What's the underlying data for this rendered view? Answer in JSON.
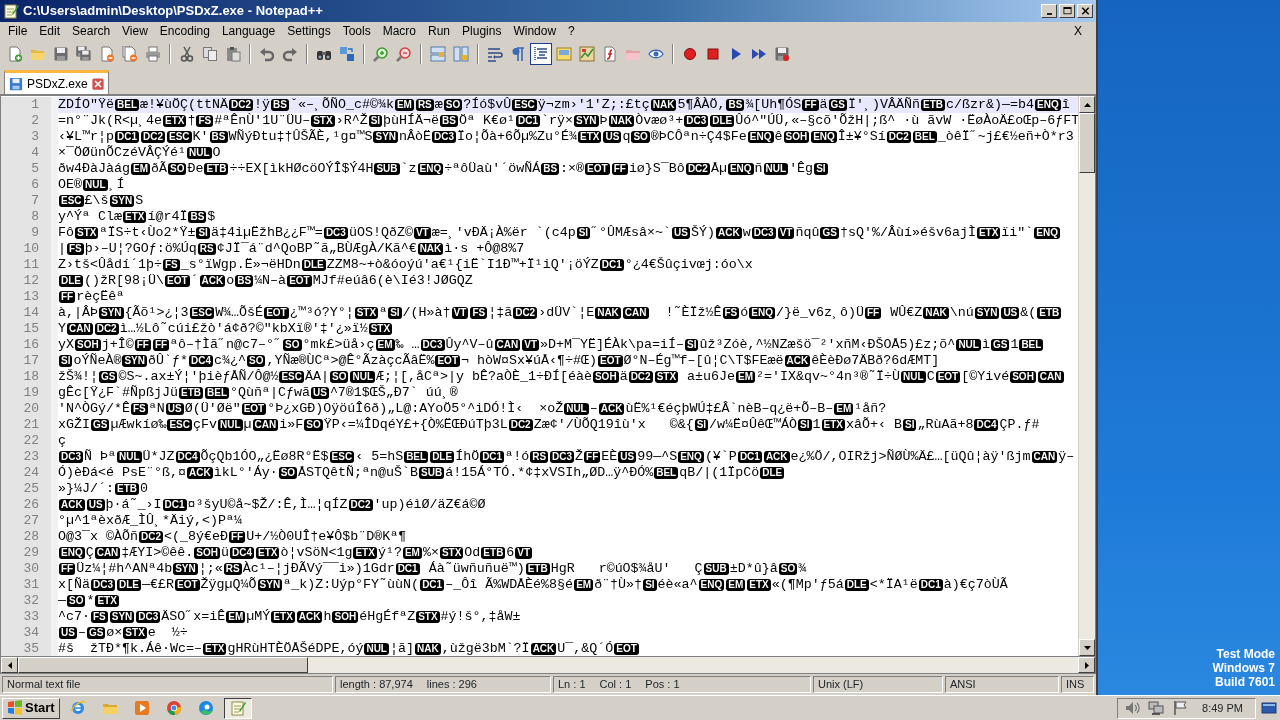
{
  "window": {
    "title": "C:\\Users\\admin\\Desktop\\PSDxZ.exe - Notepad++"
  },
  "menu": [
    {
      "label": "File"
    },
    {
      "label": "Edit"
    },
    {
      "label": "Search"
    },
    {
      "label": "View"
    },
    {
      "label": "Encoding"
    },
    {
      "label": "Language"
    },
    {
      "label": "Settings"
    },
    {
      "label": "Tools"
    },
    {
      "label": "Macro"
    },
    {
      "label": "Run"
    },
    {
      "label": "Plugins"
    },
    {
      "label": "Window"
    },
    {
      "label": "?"
    }
  ],
  "menu_close": "X",
  "toolbar": [
    {
      "kind": "new",
      "on": false
    },
    {
      "kind": "open",
      "on": false
    },
    {
      "kind": "save",
      "on": false
    },
    {
      "kind": "saveall",
      "on": false
    },
    {
      "kind": "close",
      "on": false
    },
    {
      "kind": "closeall",
      "on": false
    },
    {
      "kind": "print",
      "on": false
    },
    {
      "kind": "sep"
    },
    {
      "kind": "cut",
      "on": false
    },
    {
      "kind": "copy",
      "on": false
    },
    {
      "kind": "paste",
      "on": false
    },
    {
      "kind": "sep"
    },
    {
      "kind": "undo",
      "on": false
    },
    {
      "kind": "redo",
      "on": false
    },
    {
      "kind": "sep"
    },
    {
      "kind": "find",
      "on": false
    },
    {
      "kind": "replace",
      "on": false
    },
    {
      "kind": "sep"
    },
    {
      "kind": "zoomin",
      "on": false
    },
    {
      "kind": "zoomout",
      "on": false
    },
    {
      "kind": "sep"
    },
    {
      "kind": "syncv",
      "on": false
    },
    {
      "kind": "synch",
      "on": false
    },
    {
      "kind": "sep"
    },
    {
      "kind": "wrap",
      "on": false
    },
    {
      "kind": "allchars",
      "on": false
    },
    {
      "kind": "indent",
      "on": true
    },
    {
      "kind": "udl",
      "on": false
    },
    {
      "kind": "map",
      "on": false
    },
    {
      "kind": "funclist",
      "on": false
    },
    {
      "kind": "folder",
      "on": false
    },
    {
      "kind": "monitor",
      "on": false
    },
    {
      "kind": "sep"
    },
    {
      "kind": "record",
      "on": false
    },
    {
      "kind": "stop",
      "on": false
    },
    {
      "kind": "play",
      "on": false
    },
    {
      "kind": "playmulti",
      "on": false
    },
    {
      "kind": "savemacro",
      "on": false
    }
  ],
  "tabs": [
    {
      "label": "PSDxZ.exe",
      "selected": true
    }
  ],
  "editor": {
    "lines": [
      {
        "number": "1",
        "current": true,
        "segments": [
          {
            "text": "ZDÍO\"Ÿë"
          },
          {
            "ctrl": "BEL"
          },
          {
            "text": "æ!¥ùÖÇ(ttNÄ"
          },
          {
            "ctrl": "DC2"
          },
          {
            "text": "!ÿ"
          },
          {
            "ctrl": "BS"
          },
          {
            "text": "ˇ«–¸ÕÑO_c#©¾k"
          },
          {
            "ctrl": "EM"
          },
          {
            "ctrl": "RS"
          },
          {
            "text": "æ"
          },
          {
            "ctrl": "SO"
          },
          {
            "text": "?Íó$vÛ"
          },
          {
            "ctrl": "ESC"
          },
          {
            "text": "ÿ¬zm›'1'Z;:£tç"
          },
          {
            "ctrl": "NAK"
          },
          {
            "text": "5¶ÂÀÖ,"
          },
          {
            "ctrl": "BS"
          },
          {
            "text": "¾[Uh¶ÓS"
          },
          {
            "ctrl": "FF"
          },
          {
            "text": "ä"
          },
          {
            "ctrl": "GS"
          },
          {
            "text": "Ï'¸)VÂÄÑñ"
          },
          {
            "ctrl": "ETB"
          },
          {
            "text": "c/ßzr&)—=b4"
          },
          {
            "ctrl": "ENQ"
          },
          {
            "text": "î"
          }
        ]
      },
      {
        "number": "2",
        "current": false,
        "segments": [
          {
            "text": "=n°¨Jk(R<µ¸4e"
          },
          {
            "ctrl": "ETX"
          },
          {
            "text": "†"
          },
          {
            "ctrl": "FS"
          },
          {
            "text": "#ªÊnÙ'1U¨ÜU–"
          },
          {
            "ctrl": "STX"
          },
          {
            "text": "›R^Ž"
          },
          {
            "ctrl": "SI"
          },
          {
            "text": "þùHÍÄ¬ë"
          },
          {
            "ctrl": "BS"
          },
          {
            "text": "Öª K€ø¹"
          },
          {
            "ctrl": "DC1"
          },
          {
            "text": "`rÿ×"
          },
          {
            "ctrl": "SYN"
          },
          {
            "text": "Þ"
          },
          {
            "ctrl": "NAK"
          },
          {
            "text": "Òvæø³+"
          },
          {
            "ctrl": "DC3"
          },
          {
            "ctrl": "DLE"
          },
          {
            "text": "Ûó^\"ÚÜ,«–§cõ'ÕžH|;ß^ ·ù ãvW ·ËøÀoÄ£oŒp–6ƒFT"
          }
        ]
      },
      {
        "number": "3",
        "current": false,
        "segments": [
          {
            "text": "‹¥L™r¦p"
          },
          {
            "ctrl": "DC1"
          },
          {
            "ctrl": "DC2"
          },
          {
            "ctrl": "ESC"
          },
          {
            "text": "K'"
          },
          {
            "ctrl": "BS"
          },
          {
            "text": "WÑýÐtu‡†ÛŠÃÈ,¹g¤™S"
          },
          {
            "ctrl": "SYN"
          },
          {
            "text": "nÂòË"
          },
          {
            "ctrl": "DC3"
          },
          {
            "text": "Ïo¦Õà+6Õµ%Zu°É¾"
          },
          {
            "ctrl": "ETX"
          },
          {
            "ctrl": "US"
          },
          {
            "text": "q"
          },
          {
            "ctrl": "SO"
          },
          {
            "text": "®ÞCÔªn÷Ç4$Fe"
          },
          {
            "ctrl": "ENQ"
          },
          {
            "text": "ê"
          },
          {
            "ctrl": "SOH"
          },
          {
            "ctrl": "ENQ"
          },
          {
            "text": "Î±¥°Sí"
          },
          {
            "ctrl": "DC2"
          },
          {
            "ctrl": "BEL"
          },
          {
            "text": "_òêÏ˝~j£€½eñ+Ò*r3"
          }
        ]
      },
      {
        "number": "4",
        "current": false,
        "segments": [
          {
            "text": "×¯ÖØünÕCzéVÂÇÝé¹"
          },
          {
            "ctrl": "NUL"
          },
          {
            "text": "O"
          }
        ]
      },
      {
        "number": "5",
        "current": false,
        "segments": [
          {
            "text": "ðw4ÐàJàág"
          },
          {
            "ctrl": "EM"
          },
          {
            "text": "ðÃ"
          },
          {
            "ctrl": "SO"
          },
          {
            "text": "Ðe"
          },
          {
            "ctrl": "ETB"
          },
          {
            "text": "÷÷EX[ìkHØcöOÝÎ$Ý4H"
          },
          {
            "ctrl": "SUB"
          },
          {
            "text": "`z"
          },
          {
            "ctrl": "ENQ"
          },
          {
            "text": "÷ªôÜaù'´öwÑÁ"
          },
          {
            "ctrl": "BS"
          },
          {
            "text": ":×®"
          },
          {
            "ctrl": "EOT"
          },
          {
            "ctrl": "FF"
          },
          {
            "text": "iø}S¯Bô"
          },
          {
            "ctrl": "DC2"
          },
          {
            "text": "Åµ"
          },
          {
            "ctrl": "ENQ"
          },
          {
            "text": "ñ"
          },
          {
            "ctrl": "NUL"
          },
          {
            "text": "'Êg"
          },
          {
            "ctrl": "SI"
          }
        ]
      },
      {
        "number": "6",
        "current": false,
        "segments": [
          {
            "text": "OE®"
          },
          {
            "ctrl": "NUL"
          },
          {
            "text": "¸Í"
          }
        ]
      },
      {
        "number": "7",
        "current": false,
        "segments": [
          {
            "ctrl": "ESC"
          },
          {
            "text": "£\\š"
          },
          {
            "ctrl": "SYN"
          },
          {
            "text": "S"
          }
        ]
      },
      {
        "number": "8",
        "current": false,
        "segments": [
          {
            "text": "y^Ýª Clæ"
          },
          {
            "ctrl": "ETX"
          },
          {
            "text": "í@r4Ï"
          },
          {
            "ctrl": "BS"
          },
          {
            "text": "$"
          }
        ]
      },
      {
        "number": "9",
        "current": false,
        "segments": [
          {
            "text": "Fô"
          },
          {
            "ctrl": "STX"
          },
          {
            "text": "ªÏS÷t‹Ùo2*Ÿ±"
          },
          {
            "ctrl": "SI"
          },
          {
            "text": "ä‡4iµËžhB¿¿F™="
          },
          {
            "ctrl": "DC3"
          },
          {
            "text": "üOS!QðZ©"
          },
          {
            "ctrl": "VT"
          },
          {
            "text": "æ=¸'vÐÄ¡À%ër `(c4p"
          },
          {
            "ctrl": "SI"
          },
          {
            "text": "˝°ÛMÆsâ×~`"
          },
          {
            "ctrl": "US"
          },
          {
            "text": "ŠÝ)"
          },
          {
            "ctrl": "ACK"
          },
          {
            "text": "w"
          },
          {
            "ctrl": "DC3"
          },
          {
            "ctrl": "VT"
          },
          {
            "text": "ñqû"
          },
          {
            "ctrl": "GS"
          },
          {
            "text": "†sQ'%/Âùí»éšv6ajÌ"
          },
          {
            "ctrl": "ETX"
          },
          {
            "text": "ïi\"`"
          },
          {
            "ctrl": "ENQ"
          }
        ]
      },
      {
        "number": "10",
        "current": false,
        "segments": [
          {
            "text": "|"
          },
          {
            "ctrl": "FS"
          },
          {
            "text": "þ›–U¦?GOƒ:ö%Úq"
          },
          {
            "ctrl": "RS"
          },
          {
            "text": "¢JÏ¯á¨d^QoBP˜ã„BÙÆgÀ/Kã^€"
          },
          {
            "ctrl": "NAK"
          },
          {
            "text": "ì·s +Ô@8%7"
          }
        ]
      },
      {
        "number": "11",
        "current": false,
        "segments": [
          {
            "text": "Z›tš<Ûådí´1þ÷"
          },
          {
            "ctrl": "FS"
          },
          {
            "text": "_s°ïWgp.Ë»¬ëHDn"
          },
          {
            "ctrl": "DLE"
          },
          {
            "text": "ZZM8~+ò&óoýú'a€¹{iË`I1Ð™+Ï¹iQ'¡öÝZ"
          },
          {
            "ctrl": "DC1"
          },
          {
            "text": "°¿4€Šûçivœj:óo\\x"
          }
        ]
      },
      {
        "number": "12",
        "current": false,
        "segments": [
          {
            "ctrl": "DLE"
          },
          {
            "text": "()žR[98¡Ü\\"
          },
          {
            "ctrl": "EOT"
          },
          {
            "text": "´"
          },
          {
            "ctrl": "ACK"
          },
          {
            "text": "o"
          },
          {
            "ctrl": "BS"
          },
          {
            "text": "¼N–à"
          },
          {
            "ctrl": "EOT"
          },
          {
            "text": "MJf#eúâ6(è\\Ié3!JØGQZ"
          }
        ]
      },
      {
        "number": "13",
        "current": false,
        "segments": [
          {
            "ctrl": "FF"
          },
          {
            "text": "rèçËêª"
          }
        ]
      },
      {
        "number": "14",
        "current": false,
        "segments": [
          {
            "text": "à,|ÂÞ"
          },
          {
            "ctrl": "SYN"
          },
          {
            "text": "{Ãõ¹>¿¦3"
          },
          {
            "ctrl": "ESC"
          },
          {
            "text": "W¾…ÕšÉ"
          },
          {
            "ctrl": "EOT"
          },
          {
            "text": "¿™³ó?Y°¦"
          },
          {
            "ctrl": "STX"
          },
          {
            "text": "ª"
          },
          {
            "ctrl": "SI"
          },
          {
            "text": "/(H»à†"
          },
          {
            "ctrl": "VT"
          },
          {
            "ctrl": "FS"
          },
          {
            "text": "¦‡ã"
          },
          {
            "ctrl": "DC2"
          },
          {
            "text": "›dÜV`¦E"
          },
          {
            "ctrl": "NAK"
          },
          {
            "ctrl": "CAN"
          },
          {
            "text": "  !˜ÈÏž½Ê"
          },
          {
            "ctrl": "FS"
          },
          {
            "text": "ó"
          },
          {
            "ctrl": "ENQ"
          },
          {
            "text": "/}ë_v6z¸ô)Ü"
          },
          {
            "ctrl": "FF"
          },
          {
            "text": " WÛ€Z"
          },
          {
            "ctrl": "NAK"
          },
          {
            "text": "\\nú"
          },
          {
            "ctrl": "SYN"
          },
          {
            "ctrl": "US"
          },
          {
            "text": "&("
          },
          {
            "ctrl": "ETB"
          }
        ]
      },
      {
        "number": "15",
        "current": false,
        "segments": [
          {
            "text": "Y"
          },
          {
            "ctrl": "CAN"
          },
          {
            "ctrl": "DC2"
          },
          {
            "text": "ì…½Lô˜cúi£žò'á¢ð?©\"kbXï®'‡'¿»ï½"
          },
          {
            "ctrl": "STX"
          }
        ]
      },
      {
        "number": "16",
        "current": false,
        "segments": [
          {
            "text": "yX"
          },
          {
            "ctrl": "SOH"
          },
          {
            "text": "j+Î©"
          },
          {
            "ctrl": "FF"
          },
          {
            "ctrl": "FF"
          },
          {
            "text": "ªô–†Ìã˝n@c7–°˝"
          },
          {
            "ctrl": "SO"
          },
          {
            "text": "°mk£>üå›ç"
          },
          {
            "ctrl": "EM"
          },
          {
            "text": "‰ …"
          },
          {
            "ctrl": "DC3"
          },
          {
            "text": "Ûy^V–û"
          },
          {
            "ctrl": "CAN"
          },
          {
            "ctrl": "VT"
          },
          {
            "text": "»D+M¯YË]ÉÀk\\pa=iÍ–"
          },
          {
            "ctrl": "SI"
          },
          {
            "text": "ûž³Zóè,^½NZæšö¯²'xñM‹ÐŠOÅ5)£z;õ^"
          },
          {
            "ctrl": "NUL"
          },
          {
            "text": "ì"
          },
          {
            "ctrl": "GS"
          },
          {
            "text": "1"
          },
          {
            "ctrl": "BEL"
          }
        ]
      },
      {
        "number": "17",
        "current": false,
        "segments": [
          {
            "ctrl": "SI"
          },
          {
            "text": "oÝÑeÀ®"
          },
          {
            "ctrl": "SYN"
          },
          {
            "text": "ðÛ`ƒ*"
          },
          {
            "ctrl": "DC4"
          },
          {
            "text": "c¾¿^"
          },
          {
            "ctrl": "SO"
          },
          {
            "text": ",YÑæ®ÙCª>@Ê°ÃzàçcÃâË%"
          },
          {
            "ctrl": "EOT"
          },
          {
            "text": "¬ hòW¤Sx¥úÅ‹¶÷#Œ)"
          },
          {
            "ctrl": "EOT"
          },
          {
            "text": "Ø°N–Ég™f–[û¦C\\T$FEæë"
          },
          {
            "ctrl": "ACK"
          },
          {
            "text": "êÈèÐø7ÄBð?6dÆMT]"
          }
        ]
      },
      {
        "number": "18",
        "current": false,
        "segments": [
          {
            "text": "žŠ¾!¦"
          },
          {
            "ctrl": "GS"
          },
          {
            "text": "©S~.ax±Ý¦'þièƒÅÑ/Ô@½"
          },
          {
            "ctrl": "ESC"
          },
          {
            "text": "ÄA|"
          },
          {
            "ctrl": "SO"
          },
          {
            "ctrl": "NUL"
          },
          {
            "text": "Æ;¦[,åCª>|y bÊ?aÒÈ_1÷ÐÍ[éàè"
          },
          {
            "ctrl": "SOH"
          },
          {
            "text": "ä"
          },
          {
            "ctrl": "DC2"
          },
          {
            "ctrl": "STX"
          },
          {
            "text": " a±u6Je"
          },
          {
            "ctrl": "EM"
          },
          {
            "text": "²='IX&qv~°4n³®˜Ï÷Ù"
          },
          {
            "ctrl": "NUL"
          },
          {
            "text": "C"
          },
          {
            "ctrl": "EOT"
          },
          {
            "text": "[©Yivé"
          },
          {
            "ctrl": "SOH"
          },
          {
            "ctrl": "CAN"
          }
        ]
      },
      {
        "number": "19",
        "current": false,
        "segments": [
          {
            "text": "gÊc[Ÿ¿F`#ÑpßjJü"
          },
          {
            "ctrl": "ETB"
          },
          {
            "ctrl": "BEL"
          },
          {
            "text": "°Qùñª|Cƒwã"
          },
          {
            "ctrl": "US"
          },
          {
            "text": "^7®1$ŒŠ„Ð7` úú¸®"
          }
        ]
      },
      {
        "number": "20",
        "current": false,
        "segments": [
          {
            "text": "'N^ÒGý/*Ê"
          },
          {
            "ctrl": "FS"
          },
          {
            "text": "ªN"
          },
          {
            "ctrl": "US"
          },
          {
            "text": "Ø(Ü'Øë\""
          },
          {
            "ctrl": "EOT"
          },
          {
            "text": "°Þ¿xGÐ)OÿöúÎ6ð)„L@:AYoÖ5°^iDÓ!Ì‹  ×oŽ"
          },
          {
            "ctrl": "NUL"
          },
          {
            "text": "–"
          },
          {
            "ctrl": "ACK"
          },
          {
            "text": "ùË%¹€éçþWÚ‡£Â`nèB–q¿ë+Õ–B–"
          },
          {
            "ctrl": "EM"
          },
          {
            "text": "¹åñ?"
          }
        ]
      },
      {
        "number": "21",
        "current": false,
        "segments": [
          {
            "text": "xGŽI"
          },
          {
            "ctrl": "GS"
          },
          {
            "text": "µÆwkíø‰"
          },
          {
            "ctrl": "ESC"
          },
          {
            "text": "çFv"
          },
          {
            "ctrl": "NUL"
          },
          {
            "text": "µ"
          },
          {
            "ctrl": "CAN"
          },
          {
            "text": "i»F"
          },
          {
            "ctrl": "SO"
          },
          {
            "text": "ŸP‹=¼ÎDqéY£+{Ò%ËŒÐúTþ3L"
          },
          {
            "ctrl": "DC2"
          },
          {
            "text": "Zæ¢'/ÙÕQ19îù'x   ©&{"
          },
          {
            "ctrl": "SI"
          },
          {
            "text": "/w¼Ë¤ÛêŒ™ÁÒ"
          },
          {
            "ctrl": "SI"
          },
          {
            "text": "1"
          },
          {
            "ctrl": "ETX"
          },
          {
            "text": "xâÕ+‹ B"
          },
          {
            "ctrl": "SI"
          },
          {
            "text": "„RùAã+8"
          },
          {
            "ctrl": "DC4"
          },
          {
            "text": "ÇP.ƒ#"
          }
        ]
      },
      {
        "number": "22",
        "current": false,
        "segments": [
          {
            "text": "ç"
          }
        ]
      },
      {
        "number": "23",
        "current": false,
        "segments": [
          {
            "ctrl": "DC3"
          },
          {
            "text": "Ñ Þª"
          },
          {
            "ctrl": "NUL"
          },
          {
            "text": "Ü*JZ"
          },
          {
            "ctrl": "DC4"
          },
          {
            "text": "ÕçQb1ÓO„¿Ëø8R°Ë$"
          },
          {
            "ctrl": "ESC"
          },
          {
            "text": "‹ 5=hS"
          },
          {
            "ctrl": "BEL"
          },
          {
            "ctrl": "DLE"
          },
          {
            "text": "ÍhÖ"
          },
          {
            "ctrl": "DC1"
          },
          {
            "text": "ª!ó"
          },
          {
            "ctrl": "RS"
          },
          {
            "ctrl": "DC3"
          },
          {
            "text": "Ž"
          },
          {
            "ctrl": "FF"
          },
          {
            "text": "EÈ"
          },
          {
            "ctrl": "US"
          },
          {
            "text": "99—^S"
          },
          {
            "ctrl": "ENQ"
          },
          {
            "text": "(¥`P"
          },
          {
            "ctrl": "DC1"
          },
          {
            "ctrl": "ACK"
          },
          {
            "text": "e¿%Ö/,OIRžj>ÑØÙ%Ä£…[üQû¦àÿ'ßjm"
          },
          {
            "ctrl": "CAN"
          },
          {
            "text": "ÿ–"
          }
        ]
      },
      {
        "number": "24",
        "current": false,
        "segments": [
          {
            "text": "Ó)èÐá<é PsE¨°ß,¤"
          },
          {
            "ctrl": "ACK"
          },
          {
            "text": "ìkL°'Áy·"
          },
          {
            "ctrl": "SO"
          },
          {
            "text": "ÅSTQêtÑ;ªn@uŠ`B"
          },
          {
            "ctrl": "SUB"
          },
          {
            "text": "á!15Á°TÓ.*¢‡xVSIh„ØD…ÿ^ÐÓ%"
          },
          {
            "ctrl": "BEL"
          },
          {
            "text": "qB/|(1ÏpCö"
          },
          {
            "ctrl": "DLE"
          }
        ]
      },
      {
        "number": "25",
        "current": false,
        "segments": [
          {
            "text": "»}¼J/´:"
          },
          {
            "ctrl": "ETB"
          },
          {
            "text": "0"
          }
        ]
      },
      {
        "number": "26",
        "current": false,
        "segments": [
          {
            "ctrl": "ACK"
          },
          {
            "ctrl": "US"
          },
          {
            "text": "þ·á˜_›I"
          },
          {
            "ctrl": "DC1"
          },
          {
            "text": "¤³šyU©å~$Ž/:Ê,Ì…¦qÍZ"
          },
          {
            "ctrl": "DC2"
          },
          {
            "text": "'up)éìØ/äZ€á©Ø"
          }
        ]
      },
      {
        "number": "27",
        "current": false,
        "segments": [
          {
            "text": "°µ^1ªèxðÆ_ÌÛ¸*Äiý,<)Pª¼"
          }
        ]
      },
      {
        "number": "28",
        "current": false,
        "segments": [
          {
            "text": "O@3¯x ©ÀÕñ"
          },
          {
            "ctrl": "DC2"
          },
          {
            "text": "<(_8ý€eÐ"
          },
          {
            "ctrl": "FF"
          },
          {
            "text": "U+/½Ò0UÎ†e¥Ô$b¨D®Kª¶"
          }
        ]
      },
      {
        "number": "29",
        "current": false,
        "segments": [
          {
            "ctrl": "ENQ"
          },
          {
            "text": "Ç"
          },
          {
            "ctrl": "CAN"
          },
          {
            "text": "‡ÆYI>©êê."
          },
          {
            "ctrl": "SOH"
          },
          {
            "text": "ü"
          },
          {
            "ctrl": "DC4"
          },
          {
            "ctrl": "ETX"
          },
          {
            "text": "ò¦vSöN<1g"
          },
          {
            "ctrl": "ETX"
          },
          {
            "text": "ý¹?"
          },
          {
            "ctrl": "EM"
          },
          {
            "text": "%×"
          },
          {
            "ctrl": "STX"
          },
          {
            "text": "Od"
          },
          {
            "ctrl": "ETB"
          },
          {
            "text": "6"
          },
          {
            "ctrl": "VT"
          }
        ]
      },
      {
        "number": "30",
        "current": false,
        "segments": [
          {
            "ctrl": "FF"
          },
          {
            "text": "Üz¼¦#h^ANª4b"
          },
          {
            "ctrl": "SYN"
          },
          {
            "text": "¦;«"
          },
          {
            "ctrl": "RS"
          },
          {
            "text": "Àc¹–¦jÐÃVý¯¯i»)1Gdr"
          },
          {
            "ctrl": "DC1"
          },
          {
            "text": " Áà˜üwñuñuë™)"
          },
          {
            "ctrl": "ETB"
          },
          {
            "text": "HgR   r©úO$¾åU'   Ç"
          },
          {
            "ctrl": "SUB"
          },
          {
            "text": "±D*û}â"
          },
          {
            "ctrl": "SO"
          },
          {
            "text": "¾"
          }
        ]
      },
      {
        "number": "31",
        "current": false,
        "segments": [
          {
            "text": "x[Ñä"
          },
          {
            "ctrl": "DC3"
          },
          {
            "ctrl": "DLE"
          },
          {
            "text": "—€£R"
          },
          {
            "ctrl": "EOT"
          },
          {
            "text": "ŽÿgµQ¼Õ"
          },
          {
            "ctrl": "SYN"
          },
          {
            "text": "ª_k)Z:Uýp°FY˜ùùN("
          },
          {
            "ctrl": "DC1"
          },
          {
            "text": "–_Ôî Ã%WDÅÈé%8§é"
          },
          {
            "ctrl": "EM"
          },
          {
            "text": "ð¨†Ù»†"
          },
          {
            "ctrl": "SI"
          },
          {
            "text": "éè«a^"
          },
          {
            "ctrl": "ENQ"
          },
          {
            "ctrl": "EM"
          },
          {
            "ctrl": "ETX"
          },
          {
            "text": "«(¶Mp'ƒ5á"
          },
          {
            "ctrl": "DLE"
          },
          {
            "text": "<*ÏA¹ë"
          },
          {
            "ctrl": "DC1"
          },
          {
            "text": "à)€ç7òÙÃ"
          }
        ]
      },
      {
        "number": "32",
        "current": false,
        "segments": [
          {
            "text": "—"
          },
          {
            "ctrl": "SO"
          },
          {
            "text": "*"
          },
          {
            "ctrl": "ETX"
          }
        ]
      },
      {
        "number": "33",
        "current": false,
        "segments": [
          {
            "text": "^c7·"
          },
          {
            "ctrl": "FS"
          },
          {
            "ctrl": "SYN"
          },
          {
            "ctrl": "DC3"
          },
          {
            "text": "ÄSO˝x=iÊ"
          },
          {
            "ctrl": "EM"
          },
          {
            "text": "µMÝ"
          },
          {
            "ctrl": "ETX"
          },
          {
            "ctrl": "ACK"
          },
          {
            "text": "h"
          },
          {
            "ctrl": "SOH"
          },
          {
            "text": "éHgÉfªZ"
          },
          {
            "ctrl": "STX"
          },
          {
            "text": "#ý!š°,‡åW±"
          }
        ]
      },
      {
        "number": "34",
        "current": false,
        "segments": [
          {
            "ctrl": "US"
          },
          {
            "text": "–"
          },
          {
            "ctrl": "GS"
          },
          {
            "text": "ø×"
          },
          {
            "ctrl": "STX"
          },
          {
            "text": "e  ½÷"
          }
        ]
      },
      {
        "number": "35",
        "current": false,
        "segments": [
          {
            "text": "#š  žTÐ*¶k.Áê·Wc=–"
          },
          {
            "ctrl": "ETX"
          },
          {
            "text": "gHRùHTÈÖÅŠéDPE,óý"
          },
          {
            "ctrl": "NUL"
          },
          {
            "text": "¦ã]"
          },
          {
            "ctrl": "NAK"
          },
          {
            "text": ",ùžgë3bM`?Ï"
          },
          {
            "ctrl": "ACK"
          },
          {
            "text": "U¯,&Q´Ó"
          },
          {
            "ctrl": "EOT"
          }
        ]
      }
    ]
  },
  "status_bar": {
    "file_type": "Normal text file",
    "length": "length : 87,974",
    "lines": "lines : 296",
    "ln": "Ln : 1",
    "col": "Col : 1",
    "pos": "Pos : 1",
    "eol": "Unix (LF)",
    "encoding": "ANSI",
    "mode": "INS"
  },
  "taskbar": {
    "start": "Start",
    "apps": [
      {
        "kind": "ie",
        "active": false
      },
      {
        "kind": "explorer",
        "active": false
      },
      {
        "kind": "media",
        "active": false
      },
      {
        "kind": "chrome",
        "active": false
      },
      {
        "kind": "edge",
        "active": false
      },
      {
        "kind": "notepad",
        "active": true
      }
    ],
    "clock": "8:49 PM"
  },
  "desktop": {
    "notice": [
      "Test Mode",
      "Windows 7",
      "Build 7601"
    ]
  }
}
